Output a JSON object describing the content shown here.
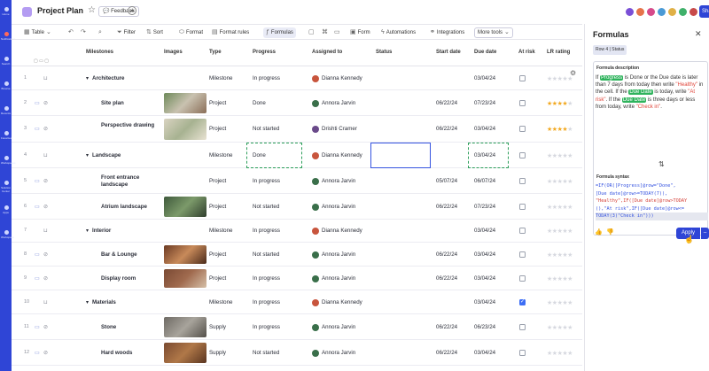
{
  "app": {
    "title": "Project Plan",
    "feedback_label": "Feedback",
    "share_label": "Share"
  },
  "rail": {
    "labels": [
      "Home",
      "Notifications",
      "Search",
      "Browse",
      "Recents",
      "Favorites",
      "Workspaces",
      "Solution Center",
      "Apps",
      "Workspace"
    ]
  },
  "avatars": [
    {
      "color": "#7a4fd6"
    },
    {
      "color": "#e6734a"
    },
    {
      "color": "#d64a8a"
    },
    {
      "color": "#4a9ad6"
    },
    {
      "color": "#e0b046"
    },
    {
      "color": "#3fb06a"
    },
    {
      "color": "#c84a4a"
    },
    {
      "color": "#5a5ad6"
    }
  ],
  "toolbar": {
    "table_label": "Table",
    "filter_label": "Filter",
    "sort_label": "Sort",
    "format_label": "Format",
    "format_rules_label": "Format rules",
    "formulas_label": "Formulas",
    "form_label": "Form",
    "automations_label": "Automations",
    "integrations_label": "Integrations",
    "more_tools_label": "More tools"
  },
  "columns": {
    "milestones": "Milestones",
    "images": "Images",
    "type": "Type",
    "progress": "Progress",
    "assigned_to": "Assigned to",
    "status": "Status",
    "start_date": "Start date",
    "due_date": "Due date",
    "at_risk": "At risk",
    "lr_rating": "LR rating"
  },
  "rows": [
    {
      "num": "1",
      "name": "Architecture",
      "parent": true,
      "type": "Milestone",
      "progress": "In progress",
      "assigned": "Dianna Kennedy",
      "start": "",
      "due": "03/04/24",
      "at_risk": false,
      "rating": 0,
      "image": ""
    },
    {
      "num": "2",
      "name": "Site plan",
      "parent": false,
      "type": "Project",
      "progress": "Done",
      "assigned": "Annora Jarvin",
      "start": "06/22/24",
      "due": "07/23/24",
      "at_risk": false,
      "rating": 4,
      "image": "site"
    },
    {
      "num": "3",
      "name": "Perspective drawing",
      "parent": false,
      "type": "Project",
      "progress": "Not started",
      "assigned": "Drishti Cramer",
      "start": "06/22/24",
      "due": "03/04/24",
      "at_risk": false,
      "rating": 4,
      "image": "plan"
    },
    {
      "num": "4",
      "name": "Landscape",
      "parent": true,
      "type": "Milestone",
      "progress": "Done",
      "assigned": "Dianna Kennedy",
      "start": "",
      "due": "03/04/24",
      "at_risk": false,
      "rating": 0,
      "image": ""
    },
    {
      "num": "5",
      "name": "Front entrance landscape",
      "parent": false,
      "type": "Project",
      "progress": "In progress",
      "assigned": "Annora Jarvin",
      "start": "05/07/24",
      "due": "06/07/24",
      "at_risk": false,
      "rating": 0,
      "image": ""
    },
    {
      "num": "6",
      "name": "Atrium landscape",
      "parent": false,
      "type": "Project",
      "progress": "Not started",
      "assigned": "Annora Jarvin",
      "start": "06/22/24",
      "due": "07/23/24",
      "at_risk": false,
      "rating": 0,
      "image": "atrium"
    },
    {
      "num": "7",
      "name": "Interior",
      "parent": true,
      "type": "Milestone",
      "progress": "In progress",
      "assigned": "Dianna Kennedy",
      "start": "",
      "due": "03/04/24",
      "at_risk": false,
      "rating": 0,
      "image": ""
    },
    {
      "num": "8",
      "name": "Bar & Lounge",
      "parent": false,
      "type": "Project",
      "progress": "Not started",
      "assigned": "Annora Jarvin",
      "start": "06/22/24",
      "due": "03/04/24",
      "at_risk": false,
      "rating": 0,
      "image": "bar"
    },
    {
      "num": "9",
      "name": "Display room",
      "parent": false,
      "type": "Project",
      "progress": "In progress",
      "assigned": "Annora Jarvin",
      "start": "06/22/24",
      "due": "03/04/24",
      "at_risk": false,
      "rating": 0,
      "image": "display"
    },
    {
      "num": "10",
      "name": "Materials",
      "parent": true,
      "type": "Milestone",
      "progress": "In progress",
      "assigned": "Dianna Kennedy",
      "start": "",
      "due": "03/04/24",
      "at_risk": true,
      "rating": 0,
      "image": ""
    },
    {
      "num": "11",
      "name": "Stone",
      "parent": false,
      "type": "Supply",
      "progress": "In progress",
      "assigned": "Annora Jarvin",
      "start": "06/22/24",
      "due": "06/23/24",
      "at_risk": false,
      "rating": 0,
      "image": "stone"
    },
    {
      "num": "12",
      "name": "Hard woods",
      "parent": false,
      "type": "Supply",
      "progress": "Not started",
      "assigned": "Annora Jarvin",
      "start": "06/22/24",
      "due": "03/04/24",
      "at_risk": false,
      "rating": 0,
      "image": "wood"
    }
  ],
  "panel": {
    "title": "Formulas",
    "context_chip": "Row 4 | Status",
    "description_label": "Formula description",
    "description_parts": {
      "p1": "If ",
      "chip1": "Progress",
      "p2": " is Done or the Due date is later than 7 days from today then write ",
      "q1": "\"Healthy\"",
      "p3": " in the cell. If the ",
      "chip2": "Due Date",
      "p4": " is today, write ",
      "q2": "\"At risk\"",
      "p5": ". If the ",
      "chip3": "Due Date",
      "p6": " is three days or less from today, write ",
      "q3": "\"Check in\"",
      "p7": "."
    },
    "syntax_label": "Formula syntax",
    "syntax_lines": [
      "=IF(OR([Progress]@row=\"Done\",",
      "[Due date]@row>=TODAY(7)),",
      "\"Healthy\",IF([Due date]@row>TODAY",
      "(),\"At risk\",IF([Due date]@row<=",
      "TODAY(3)\"Check in\")))"
    ],
    "apply_label": "Apply"
  }
}
